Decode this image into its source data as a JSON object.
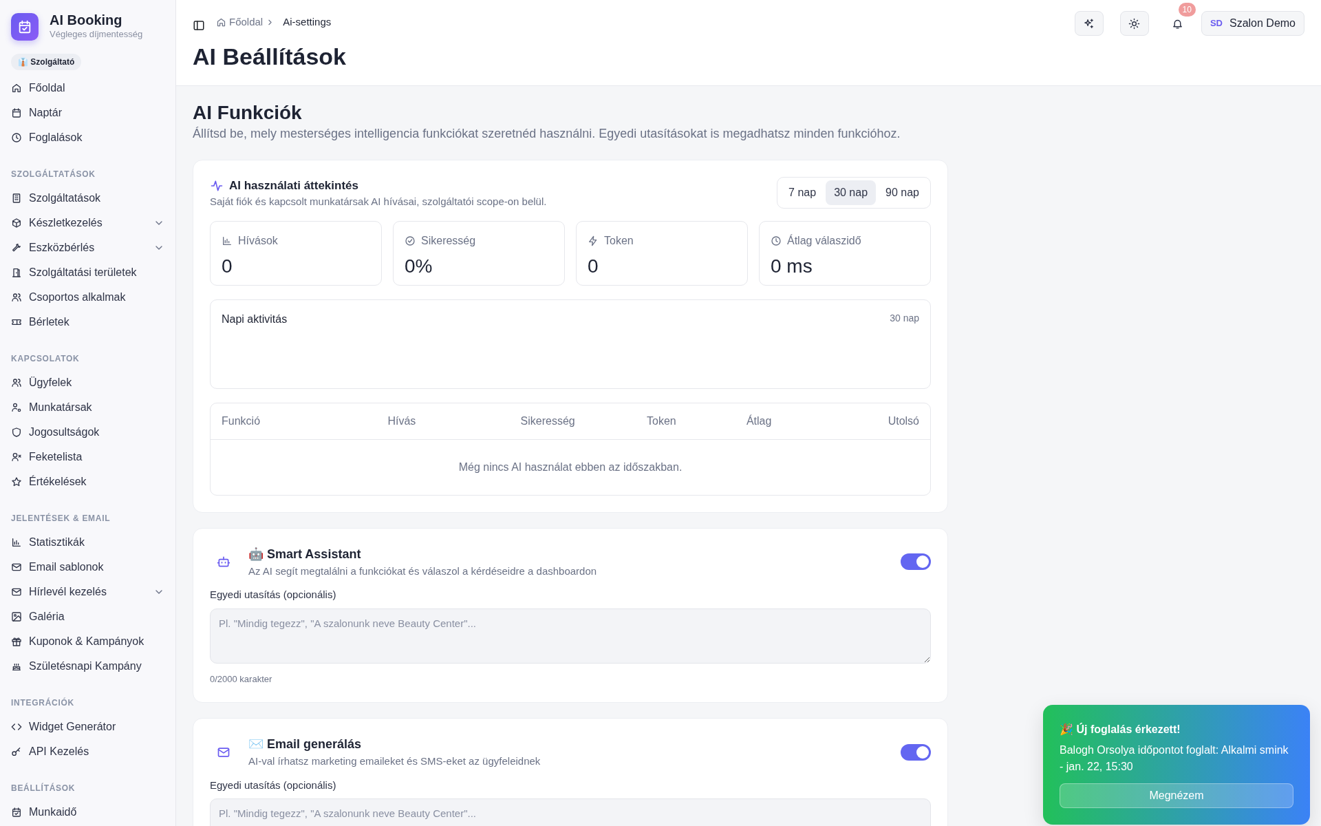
{
  "brand": {
    "name": "AI Booking",
    "subtitle": "Végleges díjmentesség",
    "role_badge": "👔 Szolgáltató"
  },
  "sidebar": {
    "sections": [
      {
        "items": [
          {
            "label": "Főoldal",
            "kind": "link"
          },
          {
            "label": "Naptár",
            "kind": "link"
          },
          {
            "label": "Foglalások",
            "kind": "link"
          }
        ]
      },
      {
        "heading": "SZOLGÁLTATÁSOK",
        "items": [
          {
            "label": "Szolgáltatások",
            "kind": "link"
          },
          {
            "label": "Készletkezelés",
            "kind": "group"
          },
          {
            "label": "Eszközbérlés",
            "kind": "group"
          },
          {
            "label": "Szolgáltatási területek",
            "kind": "link"
          },
          {
            "label": "Csoportos alkalmak",
            "kind": "link"
          },
          {
            "label": "Bérletek",
            "kind": "link"
          }
        ]
      },
      {
        "heading": "KAPCSOLATOK",
        "items": [
          {
            "label": "Ügyfelek",
            "kind": "link"
          },
          {
            "label": "Munkatársak",
            "kind": "link"
          },
          {
            "label": "Jogosultságok",
            "kind": "link"
          },
          {
            "label": "Feketelista",
            "kind": "link"
          },
          {
            "label": "Értékelések",
            "kind": "link"
          }
        ]
      },
      {
        "heading": "JELENTÉSEK & EMAIL",
        "items": [
          {
            "label": "Statisztikák",
            "kind": "link"
          },
          {
            "label": "Email sablonok",
            "kind": "link"
          },
          {
            "label": "Hírlevél kezelés",
            "kind": "group"
          },
          {
            "label": "Galéria",
            "kind": "link"
          },
          {
            "label": "Kuponok & Kampányok",
            "kind": "link"
          },
          {
            "label": "Születésnapi Kampány",
            "kind": "link"
          }
        ]
      },
      {
        "heading": "INTEGRÁCIÓK",
        "items": [
          {
            "label": "Widget Generátor",
            "kind": "link"
          },
          {
            "label": "API Kezelés",
            "kind": "link"
          }
        ]
      },
      {
        "heading": "BEÁLLÍTÁSOK",
        "items": [
          {
            "label": "Munkaidő",
            "kind": "link"
          }
        ]
      }
    ]
  },
  "header": {
    "breadcrumb": [
      "Főoldal",
      "Ai-settings"
    ],
    "notification_count": "10",
    "user_initials": "SD",
    "user_name": "Szalon Demo",
    "page_title": "AI Beállítások"
  },
  "section": {
    "title": "AI Funkciók",
    "description": "Állítsd be, mely mesterséges intelligencia funkciókat szeretnéd használni. Egyedi utasításokat is megadhatsz minden funkcióhoz."
  },
  "usage": {
    "title": "AI használati áttekintés",
    "subtitle": "Saját fiók és kapcsolt munkatársak AI hívásai, szolgáltatói scope-on belül.",
    "periods": [
      {
        "label": "7 nap",
        "selected": false
      },
      {
        "label": "30 nap",
        "selected": true
      },
      {
        "label": "90 nap",
        "selected": false
      }
    ],
    "stats": [
      {
        "label": "Hívások",
        "value": "0"
      },
      {
        "label": "Sikeresség",
        "value": "0%"
      },
      {
        "label": "Token",
        "value": "0"
      },
      {
        "label": "Átlag válaszidő",
        "value": "0 ms"
      }
    ],
    "activity": {
      "title": "Napi aktivitás",
      "range": "30 nap"
    },
    "table": {
      "columns": [
        "Funkció",
        "Hívás",
        "Sikeresség",
        "Token",
        "Átlag",
        "Utolsó"
      ],
      "empty_message": "Még nincs AI használat ebben az időszakban."
    }
  },
  "features": [
    {
      "emoji": "🤖",
      "title": "Smart Assistant",
      "description": "Az AI segít megtalálni a funkciókat és válaszol a kérdéseidre a dashboardon",
      "on": true,
      "instruction_label": "Egyedi utasítás (opcionális)",
      "placeholder": "Pl. \"Mindig tegezz\", \"A szalonunk neve Beauty Center\"...",
      "counter": "0/2000 karakter"
    },
    {
      "emoji": "✉️",
      "title": "Email generálás",
      "description": "AI-val írhatsz marketing emaileket és SMS-eket az ügyfeleidnek",
      "on": true,
      "instruction_label": "Egyedi utasítás (opcionális)",
      "placeholder": "Pl. \"Mindig tegezz\", \"A szalonunk neve Beauty Center\"..."
    }
  ],
  "toast": {
    "title": "🎉 Új foglalás érkezett!",
    "message": "Balogh Orsolya időpontot foglalt: Alkalmi smink - jan. 22, 15:30",
    "button": "Megnézem"
  }
}
